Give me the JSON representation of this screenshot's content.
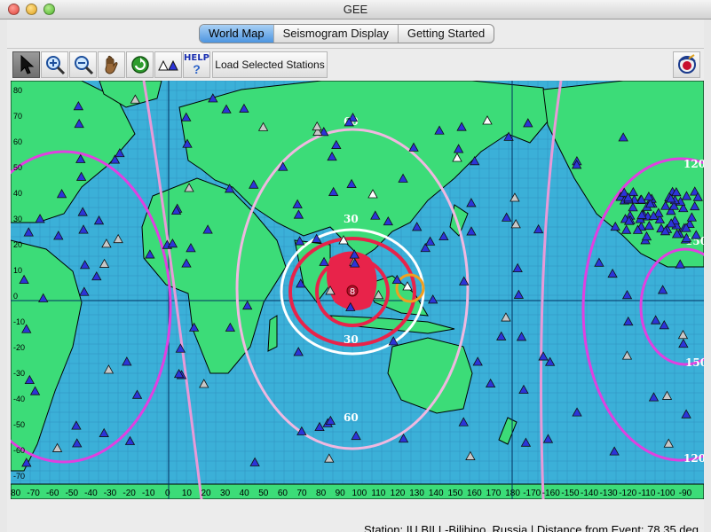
{
  "window": {
    "title": "GEE"
  },
  "tabs": [
    {
      "label": "World Map",
      "active": true
    },
    {
      "label": "Seismogram Display",
      "active": false
    },
    {
      "label": "Getting Started",
      "active": false
    }
  ],
  "toolbar": {
    "tools": [
      {
        "name": "select-tool",
        "icon": "arrow-pointer-icon",
        "active": true
      },
      {
        "name": "zoom-in-tool",
        "icon": "magnifier-plus-icon",
        "active": false
      },
      {
        "name": "zoom-out-tool",
        "icon": "magnifier-minus-icon",
        "active": false
      },
      {
        "name": "pan-tool",
        "icon": "hand-icon",
        "active": false
      },
      {
        "name": "reset-tool",
        "icon": "green-refresh-icon",
        "active": false
      },
      {
        "name": "stations-tool",
        "icon": "triangles-icon",
        "active": false
      },
      {
        "name": "help-tool",
        "icon": "help-icon",
        "label": "HELP",
        "mark": "?",
        "active": false
      }
    ],
    "load_label": "Load Selected Stations",
    "logo_icon": "seismo-logo-icon"
  },
  "map": {
    "colors": {
      "ocean": "#3bb0d8",
      "land": "#3cdc78",
      "grid": "#2a72a8"
    },
    "lon_ticks": [
      "-80",
      "-70",
      "-60",
      "-50",
      "-40",
      "-30",
      "-20",
      "-10",
      "0",
      "10",
      "20",
      "30",
      "40",
      "50",
      "60",
      "70",
      "80",
      "90",
      "100",
      "110",
      "120",
      "130",
      "140",
      "150",
      "160",
      "170",
      "180",
      "-170",
      "-160",
      "-150",
      "-140",
      "-130",
      "-120",
      "-110",
      "-100",
      "-90"
    ],
    "lat_ticks": [
      "80",
      "70",
      "60",
      "50",
      "40",
      "30",
      "20",
      "10",
      "0",
      "-10",
      "-20",
      "-30",
      "-40",
      "-50",
      "-60",
      "-70"
    ],
    "ring_labels": [
      {
        "text": "60",
        "pos": "upper"
      },
      {
        "text": "30",
        "pos": "upper"
      },
      {
        "text": "30",
        "pos": "lower"
      },
      {
        "text": "60",
        "pos": "lower"
      },
      {
        "text": "120",
        "pos": "east-upper"
      },
      {
        "text": "150",
        "pos": "east-mid"
      },
      {
        "text": "150",
        "pos": "east-lower"
      },
      {
        "text": "120",
        "pos": "east-bottom"
      }
    ],
    "event": {
      "label": "8",
      "color": "#e8234a"
    }
  },
  "status": {
    "text": "Station: IU.BILL-Bilibino, Russia | Distance from Event: 78.35 deg"
  }
}
